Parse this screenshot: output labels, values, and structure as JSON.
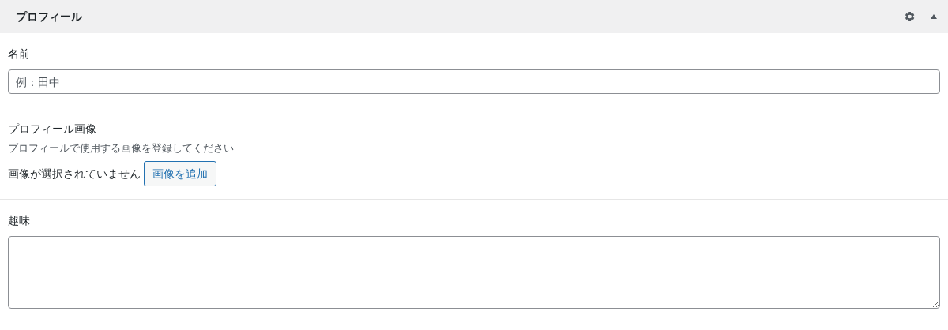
{
  "panel": {
    "title": "プロフィール",
    "expanded": true
  },
  "fields": [
    {
      "kind": "text",
      "label": "名前",
      "placeholder": "例：田中"
    },
    {
      "kind": "image",
      "label": "プロフィール画像",
      "description": "プロフィールで使用する画像を登録してください",
      "status": "画像が選択されていません",
      "button": "画像を追加"
    },
    {
      "kind": "textarea",
      "label": "趣味"
    }
  ]
}
